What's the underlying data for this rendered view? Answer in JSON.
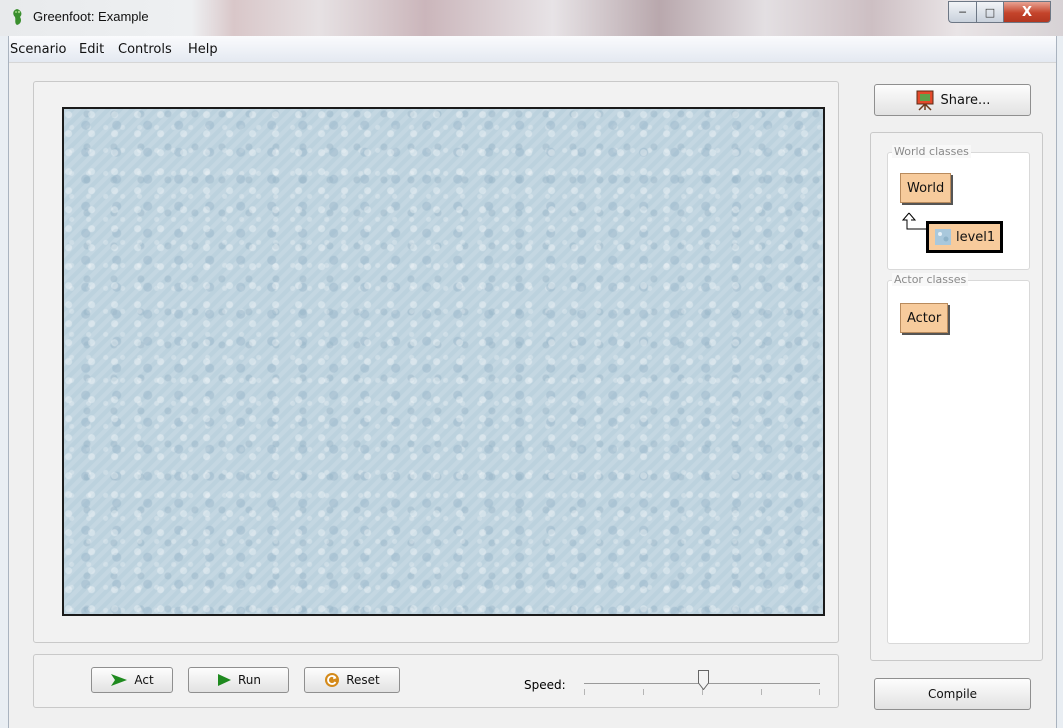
{
  "window": {
    "title": "Greenfoot: Example",
    "controls": {
      "minimize": "─",
      "maximize": "□",
      "close": "X"
    }
  },
  "menu": {
    "items": [
      "Scenario",
      "Edit",
      "Controls",
      "Help"
    ]
  },
  "controls": {
    "act_label": "Act",
    "run_label": "Run",
    "reset_label": "Reset",
    "speed_label": "Speed:",
    "speed_fraction": 0.5
  },
  "sidebar": {
    "share_label": "Share...",
    "world_classes_label": "World classes",
    "world_class": "World",
    "world_subclass": "level1",
    "actor_classes_label": "Actor classes",
    "actor_class": "Actor",
    "compile_label": "Compile"
  },
  "colors": {
    "class_box": "#f7cb9c",
    "world_background": "#bcd2de",
    "act_arrow": "#1f8a1f",
    "run_arrow": "#1f8a1f"
  },
  "icons": [
    "greenfoot-logo-icon",
    "share-easel-icon",
    "act-step-icon",
    "run-play-icon",
    "reset-icon",
    "level-world-icon",
    "inherit-arrow-icon"
  ]
}
